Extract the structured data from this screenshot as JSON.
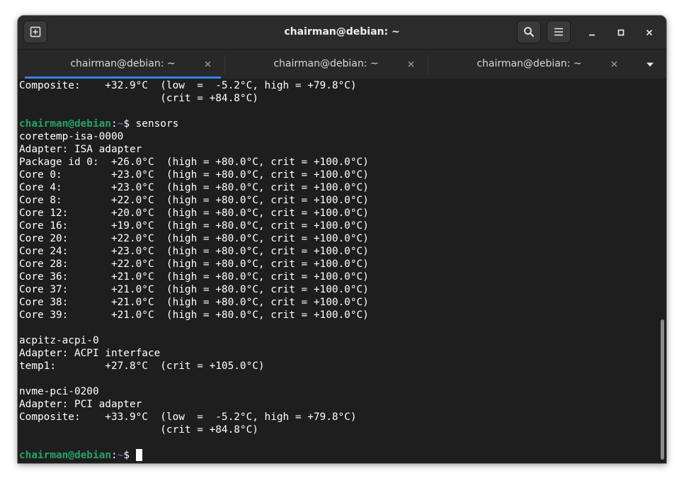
{
  "window": {
    "title": "chairman@debian: ~"
  },
  "headerbar": {
    "new_tab_icon": "new-tab-icon",
    "search_icon": "search-icon",
    "menu_icon": "hamburger-menu-icon",
    "minimize_icon": "minimize-icon",
    "maximize_icon": "maximize-icon",
    "close_icon": "close-icon"
  },
  "tabs": [
    {
      "label": "chairman@debian: ~",
      "active": true
    },
    {
      "label": "chairman@debian: ~",
      "active": false
    },
    {
      "label": "chairman@debian: ~",
      "active": false
    }
  ],
  "prompt": {
    "user_host": "chairman@debian",
    "sep": ":",
    "path": "~",
    "symbol": "$ "
  },
  "terminal": {
    "lines": [
      {
        "type": "text",
        "text": "Composite:    +32.9°C  (low  =  -5.2°C, high = +79.8°C)"
      },
      {
        "type": "text",
        "text": "                       (crit = +84.8°C)"
      },
      {
        "type": "text",
        "text": ""
      },
      {
        "type": "prompt",
        "command": "sensors"
      },
      {
        "type": "text",
        "text": "coretemp-isa-0000"
      },
      {
        "type": "text",
        "text": "Adapter: ISA adapter"
      },
      {
        "type": "text",
        "text": "Package id 0:  +26.0°C  (high = +80.0°C, crit = +100.0°C)"
      },
      {
        "type": "text",
        "text": "Core 0:        +23.0°C  (high = +80.0°C, crit = +100.0°C)"
      },
      {
        "type": "text",
        "text": "Core 4:        +23.0°C  (high = +80.0°C, crit = +100.0°C)"
      },
      {
        "type": "text",
        "text": "Core 8:        +22.0°C  (high = +80.0°C, crit = +100.0°C)"
      },
      {
        "type": "text",
        "text": "Core 12:       +20.0°C  (high = +80.0°C, crit = +100.0°C)"
      },
      {
        "type": "text",
        "text": "Core 16:       +19.0°C  (high = +80.0°C, crit = +100.0°C)"
      },
      {
        "type": "text",
        "text": "Core 20:       +22.0°C  (high = +80.0°C, crit = +100.0°C)"
      },
      {
        "type": "text",
        "text": "Core 24:       +23.0°C  (high = +80.0°C, crit = +100.0°C)"
      },
      {
        "type": "text",
        "text": "Core 28:       +22.0°C  (high = +80.0°C, crit = +100.0°C)"
      },
      {
        "type": "text",
        "text": "Core 36:       +21.0°C  (high = +80.0°C, crit = +100.0°C)"
      },
      {
        "type": "text",
        "text": "Core 37:       +21.0°C  (high = +80.0°C, crit = +100.0°C)"
      },
      {
        "type": "text",
        "text": "Core 38:       +21.0°C  (high = +80.0°C, crit = +100.0°C)"
      },
      {
        "type": "text",
        "text": "Core 39:       +21.0°C  (high = +80.0°C, crit = +100.0°C)"
      },
      {
        "type": "text",
        "text": ""
      },
      {
        "type": "text",
        "text": "acpitz-acpi-0"
      },
      {
        "type": "text",
        "text": "Adapter: ACPI interface"
      },
      {
        "type": "text",
        "text": "temp1:        +27.8°C  (crit = +105.0°C)"
      },
      {
        "type": "text",
        "text": ""
      },
      {
        "type": "text",
        "text": "nvme-pci-0200"
      },
      {
        "type": "text",
        "text": "Adapter: PCI adapter"
      },
      {
        "type": "text",
        "text": "Composite:    +33.9°C  (low  =  -5.2°C, high = +79.8°C)"
      },
      {
        "type": "text",
        "text": "                       (crit = +84.8°C)"
      },
      {
        "type": "text",
        "text": ""
      },
      {
        "type": "prompt",
        "command": "",
        "cursor": true
      }
    ]
  },
  "colors": {
    "prompt_user": "#26a269",
    "prompt_path": "#3c6eb4",
    "accent": "#3584e4",
    "background": "#1e1e1e"
  }
}
